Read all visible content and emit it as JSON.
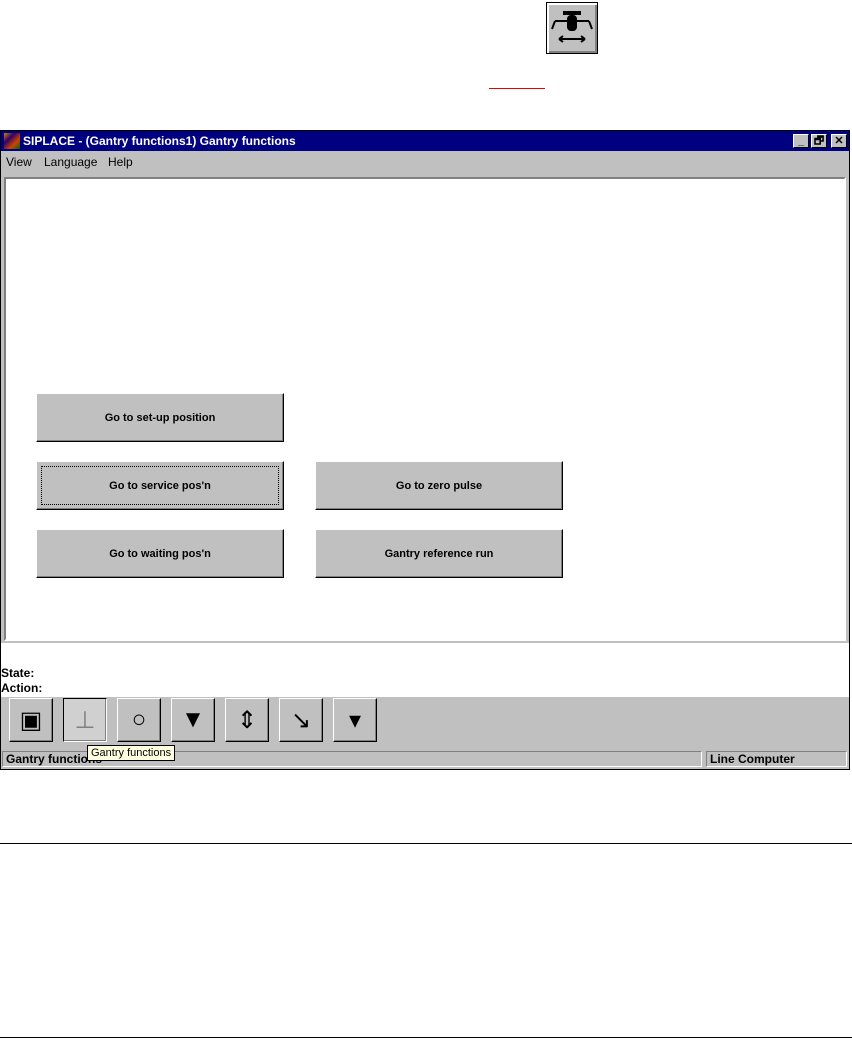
{
  "header_icon": "gantry-functions-icon",
  "window": {
    "title": "SIPLACE - (Gantry functions1) Gantry functions",
    "controls": [
      "_",
      "🗗",
      "✕"
    ]
  },
  "menu": [
    "View",
    "Language",
    "Help"
  ],
  "buttons": {
    "setup": "Go to set-up position",
    "service": "Go to service pos'n",
    "zero": "Go to zero pulse",
    "waiting": "Go to waiting pos'n",
    "reference": "Gantry reference run"
  },
  "info": {
    "state": "State:",
    "action": "Action:"
  },
  "toolbar": [
    {
      "icon": "overview-select-icon",
      "glyph": "▣"
    },
    {
      "icon": "gantry-functions-icon",
      "glyph": "⊥"
    },
    {
      "icon": "revolver-head-icon",
      "glyph": "○"
    },
    {
      "icon": "nozzle-up-icon",
      "glyph": "▼"
    },
    {
      "icon": "nozzle-height-icon",
      "glyph": "⇕"
    },
    {
      "icon": "head-rotation-icon",
      "glyph": "↘"
    },
    {
      "icon": "feeder-nozzle-icon",
      "glyph": "▾"
    }
  ],
  "tooltip": "Gantry functions",
  "status": {
    "left": "Gantry functions",
    "right": "Line Computer"
  }
}
